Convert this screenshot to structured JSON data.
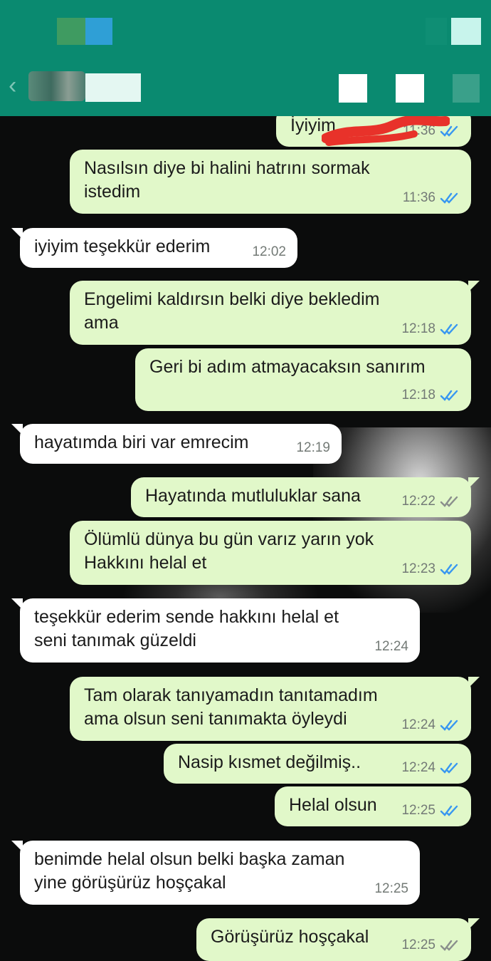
{
  "header": {
    "back_icon": "back-arrow-icon",
    "contact_name": "",
    "actions": [
      "video-call-icon",
      "voice-call-icon",
      "more-icon"
    ]
  },
  "colors": {
    "app_bar": "#0a8a70",
    "outgoing_bubble": "#e1f8c9",
    "incoming_bubble": "#ffffff",
    "read_tick": "#3897f0",
    "delivered_tick": "#8a8f8c",
    "redaction": "#e8322a"
  },
  "messages": [
    {
      "dir": "out",
      "text": "İyiyim ",
      "time": "11:36",
      "status": "read"
    },
    {
      "dir": "out",
      "text": "Nasılsın diye bi halini hatrını sormak\nistedim",
      "time": "11:36",
      "status": "read"
    },
    {
      "dir": "in",
      "text": "iyiyim teşekkür ederim",
      "time": "12:02"
    },
    {
      "dir": "out",
      "text": "Engelimi kaldırsın belki diye bekledim\nama",
      "time": "12:18",
      "status": "read"
    },
    {
      "dir": "out",
      "text": "Geri bi adım atmayacaksın sanırım",
      "time": "12:18",
      "status": "read"
    },
    {
      "dir": "in",
      "text": "hayatımda biri var emrecim",
      "time": "12:19"
    },
    {
      "dir": "out",
      "text": "Hayatında mutluluklar sana",
      "time": "12:22",
      "status": "delivered"
    },
    {
      "dir": "out",
      "text": "Ölümlü dünya bu gün varız yarın yok\nHakkını helal et",
      "time": "12:23",
      "status": "read"
    },
    {
      "dir": "in",
      "text": "teşekkür ederim sende hakkını helal et\nseni tanımak güzeldi",
      "time": "12:24"
    },
    {
      "dir": "out",
      "text": "Tam olarak tanıyamadın tanıtamadım\nama olsun seni tanımakta öyleydi",
      "time": "12:24",
      "status": "read"
    },
    {
      "dir": "out",
      "text": "Nasip kısmet değilmiş..",
      "time": "12:24",
      "status": "read"
    },
    {
      "dir": "out",
      "text": "Helal olsun",
      "time": "12:25",
      "status": "read"
    },
    {
      "dir": "in",
      "text": "benimde helal olsun belki başka zaman\nyine görüşürüz hoşçakal",
      "time": "12:25"
    },
    {
      "dir": "out",
      "text": "Görüşürüz hoşçakal",
      "time": "12:25",
      "status": "delivered"
    }
  ]
}
